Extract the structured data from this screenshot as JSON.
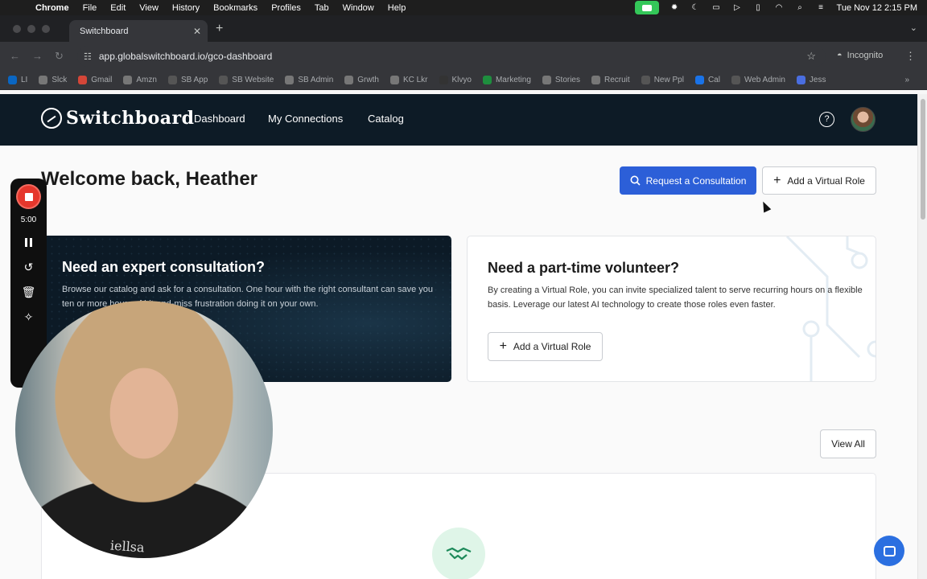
{
  "menubar": {
    "app": "Chrome",
    "items": [
      "File",
      "Edit",
      "View",
      "History",
      "Bookmarks",
      "Profiles",
      "Tab",
      "Window",
      "Help"
    ],
    "datetime": "Tue Nov 12  2:15 PM"
  },
  "browser": {
    "tab_title": "Switchboard",
    "url": "app.globalswitchboard.io/gco-dashboard",
    "incognito_label": "Incognito",
    "bookmarks": [
      {
        "label": "LI",
        "color": "#0a66c2"
      },
      {
        "label": "Slck",
        "color": "#777"
      },
      {
        "label": "Gmail",
        "color": "#d44638"
      },
      {
        "label": "Amzn",
        "color": "#777"
      },
      {
        "label": "SB App",
        "color": "#555"
      },
      {
        "label": "SB Website",
        "color": "#555"
      },
      {
        "label": "SB Admin",
        "color": "#777"
      },
      {
        "label": "Grwth",
        "color": "#777"
      },
      {
        "label": "KC Lkr",
        "color": "#777"
      },
      {
        "label": "Klvyo",
        "color": "#333"
      },
      {
        "label": "Marketing",
        "color": "#1e8e3e"
      },
      {
        "label": "Stories",
        "color": "#777"
      },
      {
        "label": "Recruit",
        "color": "#777"
      },
      {
        "label": "New Ppl",
        "color": "#555"
      },
      {
        "label": "Cal",
        "color": "#1a73e8"
      },
      {
        "label": "Web Admin",
        "color": "#555"
      },
      {
        "label": "Jess",
        "color": "#4a6ee0"
      }
    ]
  },
  "app": {
    "brand": "Switchboard",
    "nav": [
      "Dashboard",
      "My Connections",
      "Catalog"
    ],
    "help_symbol": "?"
  },
  "page": {
    "welcome": "Welcome back, Heather",
    "request_btn": "Request a Consultation",
    "add_role_btn": "Add a Virtual Role",
    "card_expert": {
      "title": "Need an expert consultation?",
      "body": "Browse our catalog and ask for a consultation. One hour with the right consultant can save you ten or more hours of hit-and-miss frustration doing it on your own."
    },
    "card_volunteer": {
      "title": "Need a part-time volunteer?",
      "body": "By creating a Virtual Role, you can invite specialized talent to serve recurring hours on a flexible basis. Leverage our latest AI technology to create those roles even faster.",
      "button": "Add a Virtual Role"
    },
    "view_all": "View All"
  },
  "recorder": {
    "time": "5:00",
    "shirt_text": "iellsa"
  },
  "icons": {
    "search": "search-icon",
    "plus": "plus-icon",
    "handshake": "handshake-icon",
    "chat": "chat-icon"
  },
  "colors": {
    "primary": "#2c5fd8",
    "header_bg": "#0d1b26",
    "record": "#e5372c"
  }
}
